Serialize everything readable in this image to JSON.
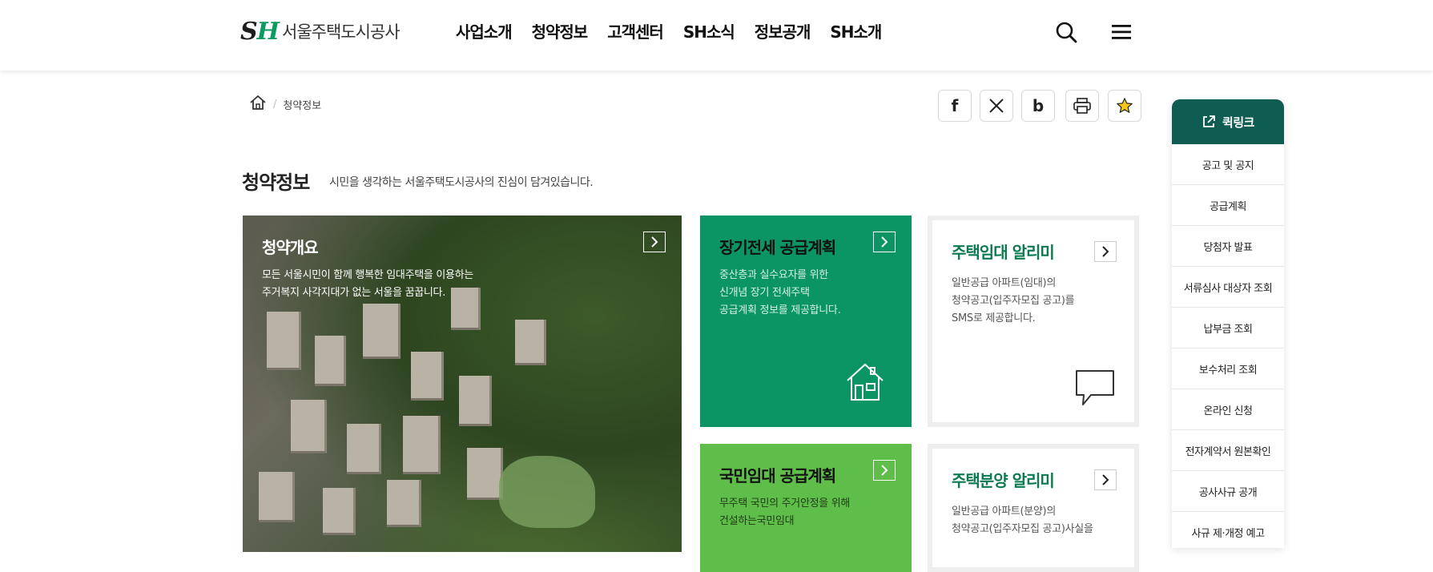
{
  "header": {
    "logo_mark_s": "S",
    "logo_mark_h": "H",
    "logo_text": "서울주택도시공사",
    "nav": [
      "사업소개",
      "청약정보",
      "고객센터",
      "SH소식",
      "정보공개",
      "SH소개"
    ],
    "search_icon": "search-icon",
    "menu_icon": "hamburger-menu-icon"
  },
  "breadcrumb": {
    "home_icon": "home-icon",
    "separator": "/",
    "current": "청약정보"
  },
  "share": {
    "facebook": "f",
    "x": "X",
    "blog": "b",
    "print_icon": "print-icon",
    "favorite_icon": "star-icon",
    "favorite_color": "#f5c518"
  },
  "page": {
    "title": "청약정보",
    "subtitle": "시민을 생각하는 서울주택도시공사의 진심이 담겨있습니다."
  },
  "cards": {
    "overview": {
      "title": "청약개요",
      "desc_line1": "모든 서울시민이 함께 행복한 임대주택을 이용하는",
      "desc_line2": "주거복지 사각지대가 없는 서울을 꿈꿉니다."
    },
    "jeonse": {
      "title": "장기전세 공급계획",
      "desc_line1": "중산층과 실수요자를 위한",
      "desc_line2": "신개념 장기 전세주택",
      "desc_line3": "공급계획 정보를 제공합니다.",
      "icon": "house-icon"
    },
    "rental_alert": {
      "title": "주택임대 알리미",
      "desc_line1": "일반공급 아파트(임대)의",
      "desc_line2": "청약공고(입주자모집 공고)를",
      "desc_line3": "SMS로 제공합니다.",
      "icon": "speech-bubble-icon"
    },
    "national": {
      "title": "국민임대 공급계획",
      "desc_line1": "무주택 국민의 주거안정을 위해",
      "desc_line2": "건설하는국민임대"
    },
    "sale_alert": {
      "title": "주택분양 알리미",
      "desc_line1": "일반공급 아파트(분양)의",
      "desc_line2": "청약공고(입주자모집 공고)사실을"
    }
  },
  "colors": {
    "brand_green": "#0b9564",
    "light_green": "#5fbe4a",
    "quick_header": "#0f5c52",
    "title_green": "#0b7a4f"
  },
  "quick_link": {
    "title": "퀵링크",
    "icon": "external-link-icon",
    "items": [
      "공고 및 공지",
      "공급계획",
      "당첨자 발표",
      "서류심사 대상자 조회",
      "납부금 조회",
      "보수처리 조회",
      "온라인 신청",
      "전자계약서 원본확인",
      "공사사규 공개",
      "사규 제·개정 예고"
    ]
  }
}
